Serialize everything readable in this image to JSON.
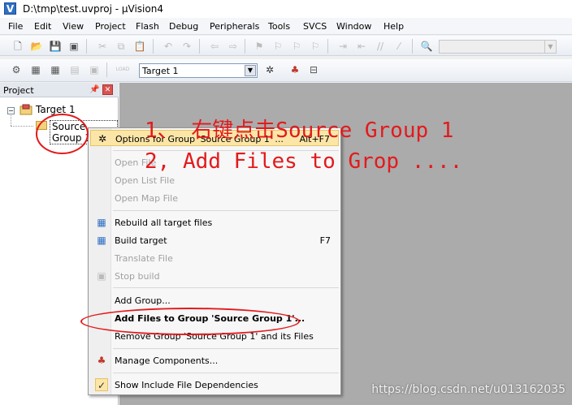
{
  "window": {
    "title": "D:\\tmp\\test.uvproj - µVision4",
    "app_icon": "V"
  },
  "menubar": [
    "File",
    "Edit",
    "View",
    "Project",
    "Flash",
    "Debug",
    "Peripherals",
    "Tools",
    "SVCS",
    "Window",
    "Help"
  ],
  "toolbar2": {
    "target_select": "Target 1",
    "load_label": "LOAD"
  },
  "project_panel": {
    "title": "Project",
    "pin_icon": "pin-icon",
    "close_icon": "close-icon",
    "tree": {
      "root": "Target 1",
      "group": "Source Group 1"
    }
  },
  "context_menu": {
    "items": [
      {
        "label": "Options for Group 'Source Group 1' ...",
        "shortcut": "Alt+F7",
        "icon": "options-icon",
        "state": "highlighted"
      },
      {
        "label": "Open File",
        "shortcut": "",
        "state": "disabled"
      },
      {
        "label": "Open List File",
        "shortcut": "",
        "state": "disabled"
      },
      {
        "label": "Open Map File",
        "shortcut": "",
        "state": "disabled"
      },
      {
        "label": "Rebuild all target files",
        "shortcut": "",
        "icon": "rebuild-icon",
        "state": "enabled"
      },
      {
        "label": "Build target",
        "shortcut": "F7",
        "icon": "build-icon",
        "state": "enabled"
      },
      {
        "label": "Translate File",
        "shortcut": "",
        "state": "disabled"
      },
      {
        "label": "Stop build",
        "shortcut": "",
        "icon": "stop-build-icon",
        "state": "disabled"
      },
      {
        "label": "Add Group...",
        "shortcut": "",
        "state": "enabled"
      },
      {
        "label": "Add Files to Group 'Source Group 1'...",
        "shortcut": "",
        "state": "bold"
      },
      {
        "label": "Remove Group 'Source Group 1' and its Files",
        "shortcut": "",
        "state": "enabled"
      },
      {
        "label": "Manage Components...",
        "shortcut": "",
        "icon": "components-icon",
        "state": "enabled"
      },
      {
        "label": "Show Include File Dependencies",
        "shortcut": "",
        "icon": "checkmark-icon",
        "state": "checked"
      }
    ]
  },
  "annotations": {
    "step1": "1、 右键点击Source Group 1",
    "step2": "2, Add Files to Grop ....",
    "color": "#e31a1c"
  },
  "watermark": "https://blog.csdn.net/u013162035"
}
